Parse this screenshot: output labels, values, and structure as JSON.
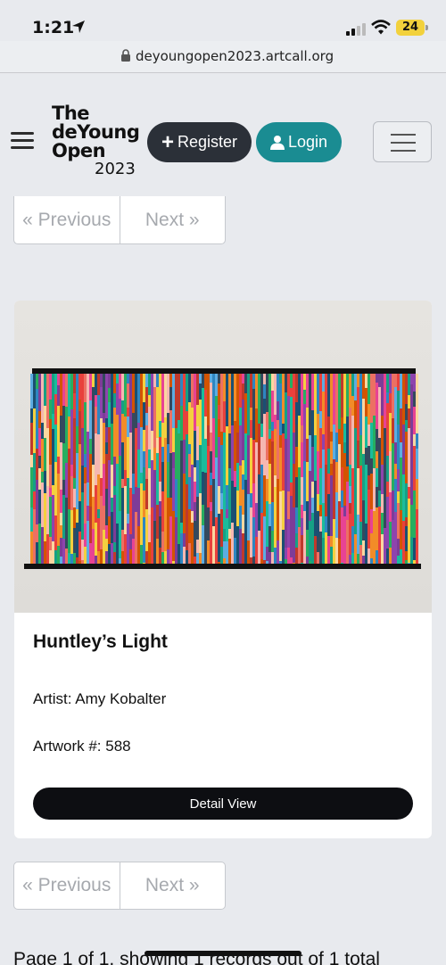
{
  "status_bar": {
    "time": "1:21",
    "battery": "24"
  },
  "browser": {
    "url": "deyoungopen2023.artcall.org"
  },
  "header": {
    "logo": {
      "line1": "The",
      "line2": "deYoung",
      "line3": "Open",
      "year": "2023"
    },
    "register_label": "Register",
    "login_label": "Login"
  },
  "pagination": {
    "previous_label": "« Previous",
    "next_label": "Next »"
  },
  "artwork": {
    "title": "Huntley’s Light",
    "artist": "Artist: Amy Kobalter",
    "artwork_number": "Artwork #: 588",
    "detail_button": "Detail View"
  },
  "footer": {
    "summary": "Page 1 of 1, showing 1 records out of 1 total"
  },
  "colors": {
    "register_bg": "#2b3038",
    "login_bg": "#1a8c92",
    "detail_bg": "#0d0e12",
    "page_bg": "#e8eaee"
  }
}
